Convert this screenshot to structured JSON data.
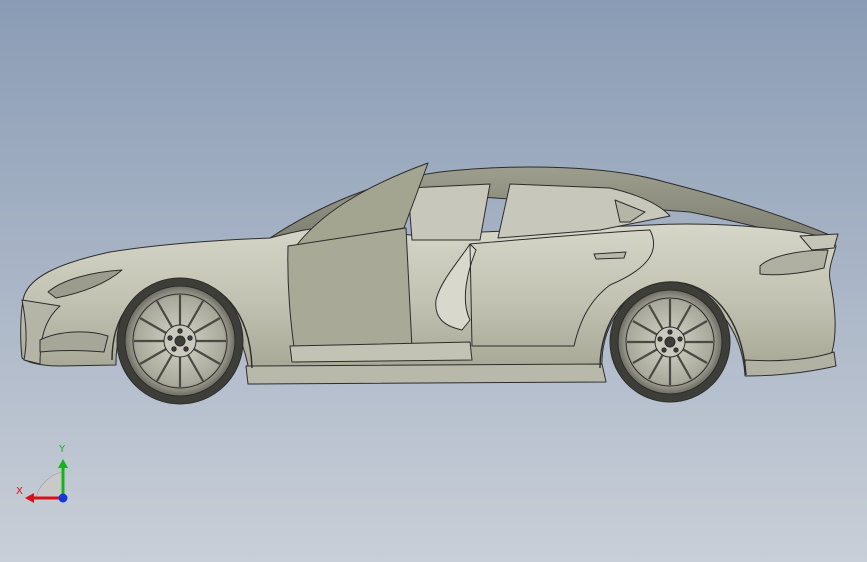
{
  "viewport": {
    "background_top": "#8a9cb5",
    "background_bottom": "#c9cfd8"
  },
  "model": {
    "body_color": "#c3c3b4",
    "door_color": "#a8a996",
    "edge_color": "#2c2c2c"
  },
  "triad": {
    "x_label": "X",
    "y_label": "Y",
    "x_color": "#d8101a",
    "y_color": "#14b31a",
    "z_color": "#1a37d6"
  }
}
